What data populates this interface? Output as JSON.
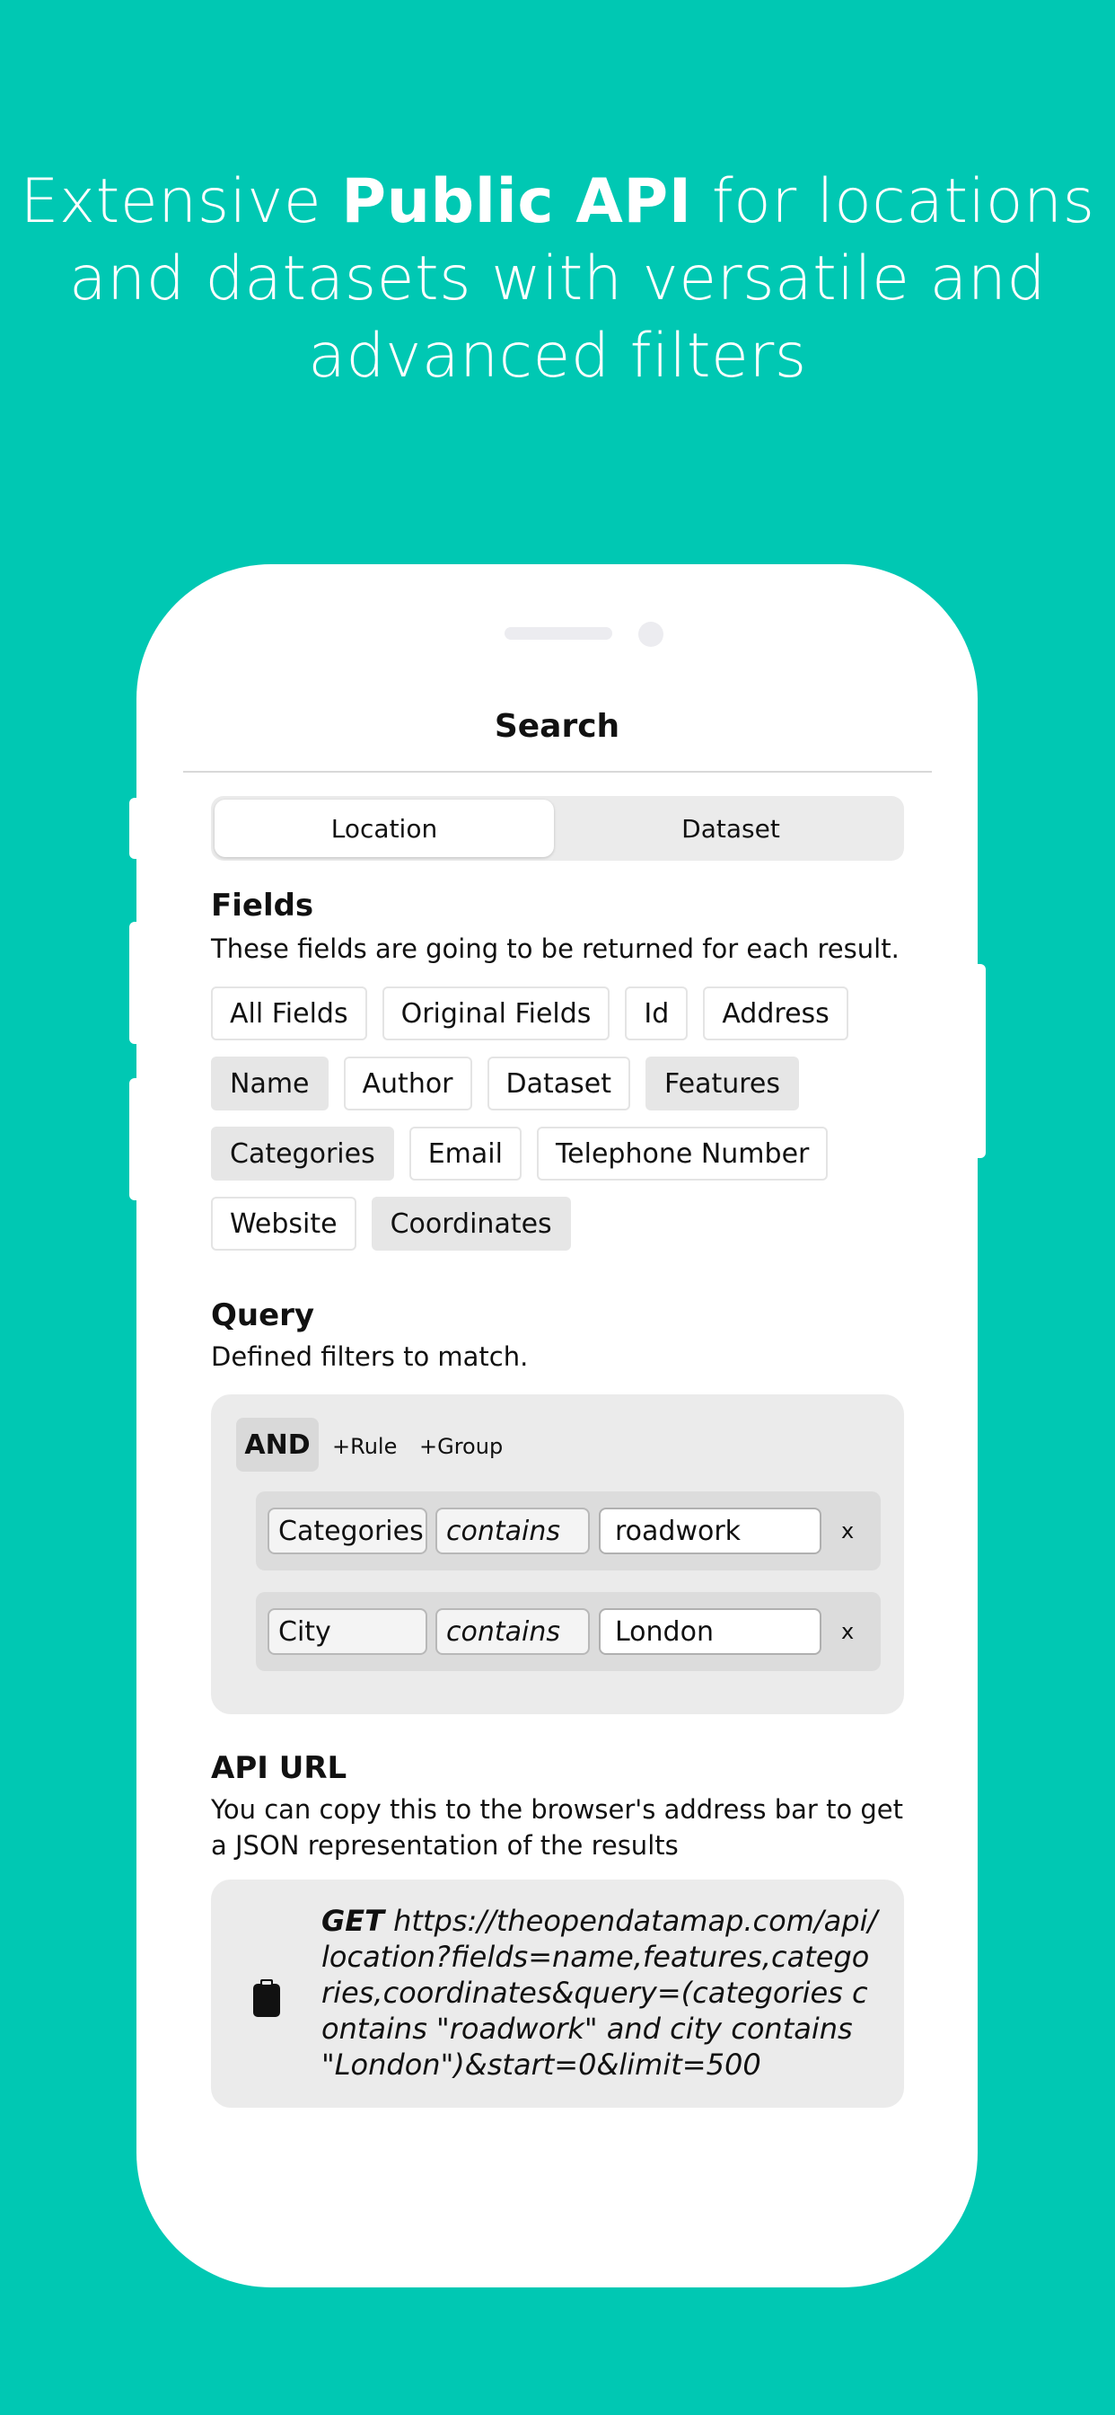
{
  "headline": {
    "pre": "Extensive ",
    "bold": "Public API",
    "post": " for locations and datasets with versatile and advanced filters"
  },
  "nav": {
    "title": "Search"
  },
  "segmented": {
    "options": [
      "Location",
      "Dataset"
    ],
    "selected": "Location"
  },
  "fields": {
    "title": "Fields",
    "description": "These fields are going to be returned for each result.",
    "chips": [
      {
        "label": "All Fields",
        "selected": false
      },
      {
        "label": "Original Fields",
        "selected": false
      },
      {
        "label": "Id",
        "selected": false
      },
      {
        "label": "Address",
        "selected": false
      },
      {
        "label": "Name",
        "selected": true
      },
      {
        "label": "Author",
        "selected": false
      },
      {
        "label": "Dataset",
        "selected": false
      },
      {
        "label": "Features",
        "selected": true
      },
      {
        "label": "Categories",
        "selected": true
      },
      {
        "label": "Email",
        "selected": false
      },
      {
        "label": "Telephone Number",
        "selected": false
      },
      {
        "label": "Website",
        "selected": false
      },
      {
        "label": "Coordinates",
        "selected": true
      }
    ]
  },
  "query": {
    "title": "Query",
    "description": "Defined filters to match.",
    "combinator": "AND",
    "add_rule": "+Rule",
    "add_group": "+Group",
    "rules": [
      {
        "field": "Categories",
        "operator": "contains",
        "value": "roadwork",
        "remove": "x"
      },
      {
        "field": "City",
        "operator": "contains",
        "value": "London",
        "remove": "x"
      }
    ]
  },
  "api": {
    "title": "API URL",
    "description": "You can copy this to the browser's address bar to get a JSON representation of the results",
    "method": "GET",
    "url": " https://theopendatamap.com/api/ location?fields=name,features,categories,coordinates&query=(categories contains \"roadwork\" and city contains \"London\")&start=0&limit=500",
    "copy_icon": "clipboard-icon"
  },
  "colors": {
    "background": "#00c8b3",
    "chip_selected": "#e6e6e6"
  }
}
